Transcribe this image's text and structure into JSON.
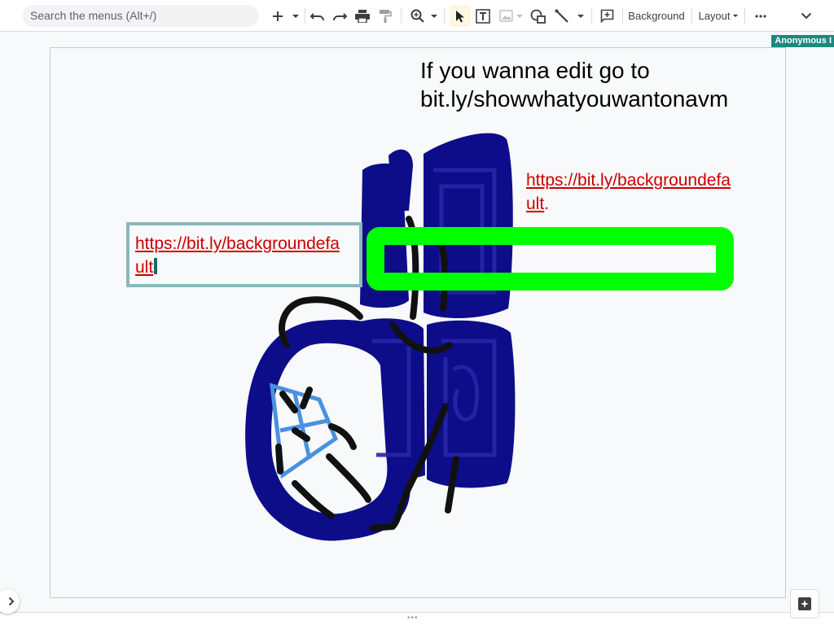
{
  "toolbar": {
    "search_placeholder": "Search the menus (Alt+/)",
    "background_label": "Background",
    "layout_label": "Layout",
    "icons": [
      "add-icon",
      "dropdown-icon",
      "undo-icon",
      "redo-icon",
      "print-icon",
      "paint-format-icon",
      "zoom-icon",
      "select-icon",
      "text-box-icon",
      "image-icon",
      "shape-icon",
      "line-icon",
      "comment-icon",
      "more-icon",
      "collapse-icon"
    ]
  },
  "presence": {
    "user_label": "Anonymous I"
  },
  "slide": {
    "title_line1": "If you wanna edit go to",
    "title_line2": "bit.ly/showwhatyouwantonavm",
    "link_right_line1": "https://bit.ly/backgroundefa",
    "link_right_line2": "ult",
    "link_right_suffix": ".",
    "link_left_line1": "https://bit.ly/backgroundefa",
    "link_left_line2": "ult",
    "colors": {
      "navy_drawing": "#0d0d8a",
      "green_rect": "#00ff00",
      "light_blue": "#4a90e2",
      "black_strokes": "#111111",
      "link_red": "#cc0000",
      "selection_border": "#89b8bd"
    }
  },
  "footer": {
    "drag_handle": "•••"
  }
}
